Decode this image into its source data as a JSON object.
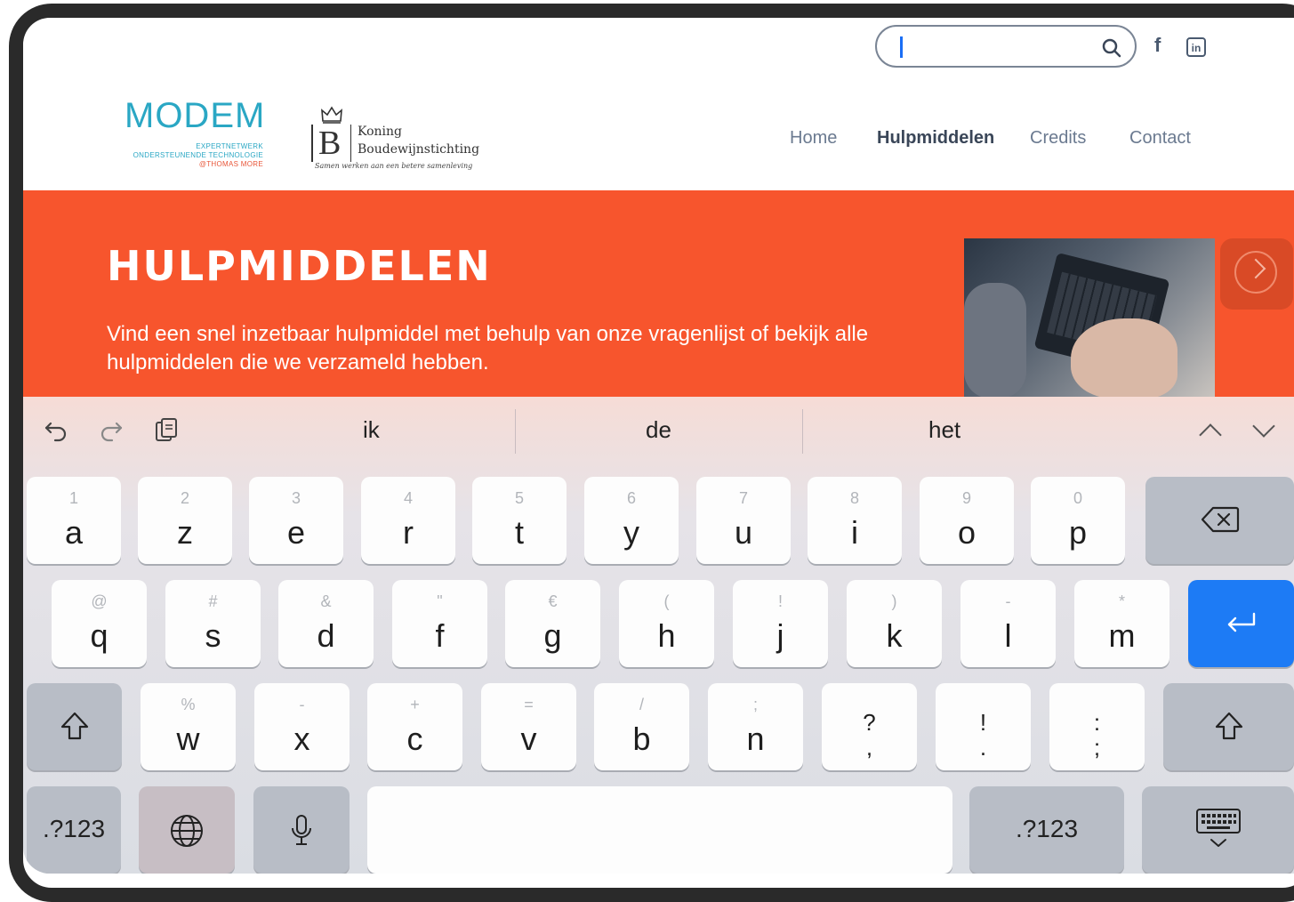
{
  "header": {
    "search": {
      "value": "",
      "placeholder": ""
    },
    "social": {
      "facebook": "f",
      "linkedin": "in"
    },
    "logo_modem": {
      "word": "MODEM",
      "line1": "EXPERTNETWERK",
      "line2": "ONDERSTEUNENDE TECHNOLOGIE",
      "line3": "@THOMAS MORE"
    },
    "logo_kbs": {
      "letter": "B",
      "line1": "Koning",
      "line2": "Boudewijnstichting",
      "tagline": "Samen werken aan een betere samenleving"
    },
    "nav": [
      {
        "label": "Home",
        "active": false
      },
      {
        "label": "Hulpmiddelen",
        "active": true
      },
      {
        "label": "Credits",
        "active": false
      },
      {
        "label": "Contact",
        "active": false
      }
    ]
  },
  "banner": {
    "title": "HULPMIDDELEN",
    "text": "Vind een snel inzetbaar hulpmiddel met behulp van onze vragenlijst of bekijk alle hulpmiddelen die we verzameld hebben.",
    "background": "#f7552d"
  },
  "keyboard": {
    "suggestions": [
      "ik",
      "de",
      "het"
    ],
    "row1": [
      {
        "sec": "1",
        "pri": "a"
      },
      {
        "sec": "2",
        "pri": "z"
      },
      {
        "sec": "3",
        "pri": "e"
      },
      {
        "sec": "4",
        "pri": "r"
      },
      {
        "sec": "5",
        "pri": "t"
      },
      {
        "sec": "6",
        "pri": "y"
      },
      {
        "sec": "7",
        "pri": "u"
      },
      {
        "sec": "8",
        "pri": "i"
      },
      {
        "sec": "9",
        "pri": "o"
      },
      {
        "sec": "0",
        "pri": "p"
      }
    ],
    "row2": [
      {
        "sec": "@",
        "pri": "q"
      },
      {
        "sec": "#",
        "pri": "s"
      },
      {
        "sec": "&",
        "pri": "d"
      },
      {
        "sec": "\"",
        "pri": "f"
      },
      {
        "sec": "€",
        "pri": "g"
      },
      {
        "sec": "(",
        "pri": "h"
      },
      {
        "sec": "!",
        "pri": "j"
      },
      {
        "sec": ")",
        "pri": "k"
      },
      {
        "sec": "-",
        "pri": "l"
      },
      {
        "sec": "*",
        "pri": "m"
      }
    ],
    "row3": [
      {
        "sec": "%",
        "pri": "w"
      },
      {
        "sec": "-",
        "pri": "x"
      },
      {
        "sec": "+",
        "pri": "c"
      },
      {
        "sec": "=",
        "pri": "v"
      },
      {
        "sec": "/",
        "pri": "b"
      },
      {
        "sec": ";",
        "pri": "n"
      },
      {
        "sec": "",
        "pri": "?\n,"
      },
      {
        "sec": "",
        "pri": "!\n."
      },
      {
        "sec": "",
        "pri": ":\n;"
      }
    ],
    "numbers_label": ".?123",
    "accent": "#1d7bf5"
  }
}
